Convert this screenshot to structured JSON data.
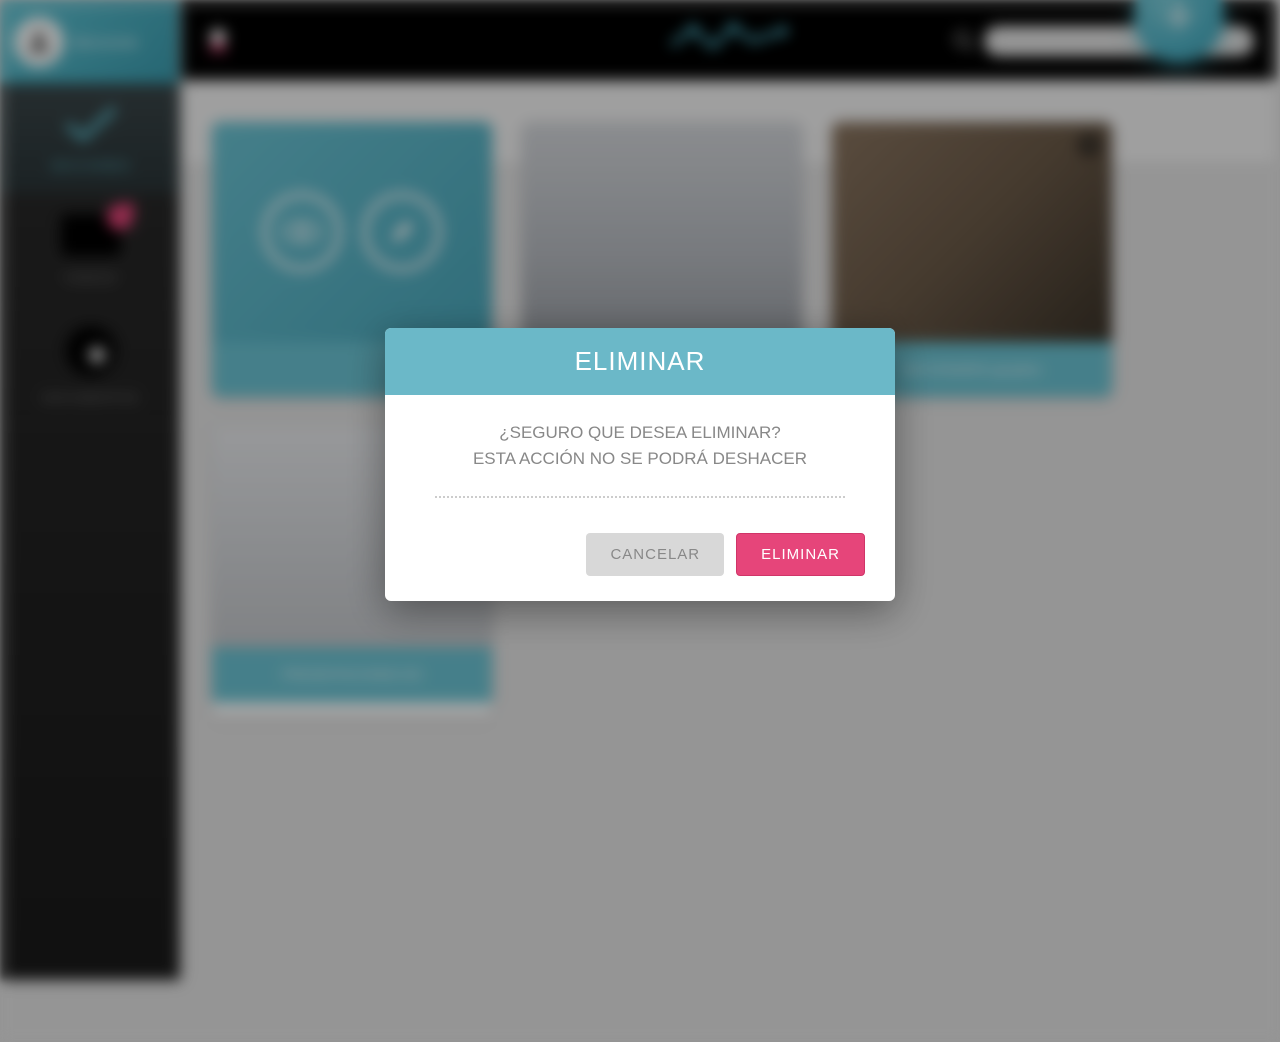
{
  "sidebar": {
    "username": "Bienvenido",
    "items": [
      {
        "label": "SECCIONES",
        "active": true
      },
      {
        "label": "VIDEOS",
        "active": false
      },
      {
        "label": "DOCUMENTOS",
        "active": false
      }
    ]
  },
  "topbar": {
    "search_placeholder": ""
  },
  "cards": [
    {
      "caption": ""
    },
    {
      "caption": ""
    },
    {
      "caption": "DICCIONARIO gespline"
    },
    {
      "caption": "PRESENTACIONES ED"
    }
  ],
  "fab": {
    "glyph": "+"
  },
  "modal": {
    "title": "ELIMINAR",
    "message_line1": "¿SEGURO QUE DESEA ELIMINAR?",
    "message_line2": "ESTA ACCIÓN NO SE PODRÁ DESHACER",
    "cancel_label": "CANCELAR",
    "confirm_label": "ELIMINAR"
  },
  "colors": {
    "accent_teal": "#6bc4d4",
    "accent_pink": "#e6457a",
    "sidebar_dark": "#1a1a1a"
  }
}
